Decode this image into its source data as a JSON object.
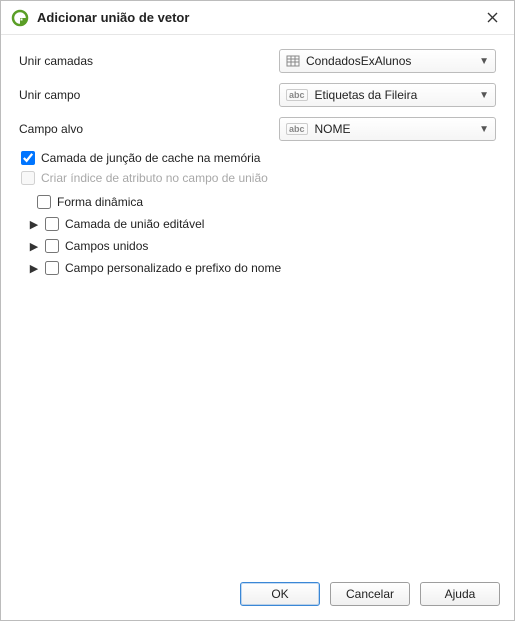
{
  "window": {
    "title": "Adicionar união de vetor"
  },
  "form": {
    "joinLayer": {
      "label": "Unir camadas",
      "value": "CondadosExAlunos"
    },
    "joinField": {
      "label": "Unir campo",
      "value": "Etiquetas da Fileira"
    },
    "targetField": {
      "label": "Campo alvo",
      "value": "NOME"
    }
  },
  "options": {
    "cacheJoin": {
      "label": "Camada de junção de cache na memória",
      "checked": true
    },
    "createIndex": {
      "label": "Criar índice de atributo no campo de união",
      "checked": false,
      "disabled": true
    },
    "dynamicForm": {
      "label": "Forma dinâmica",
      "checked": false
    },
    "editableJoin": {
      "label": "Camada de união editável",
      "checked": false
    },
    "joinedFields": {
      "label": "Campos unidos",
      "checked": false
    },
    "customPrefix": {
      "label": "Campo personalizado e prefixo do nome",
      "checked": false
    }
  },
  "buttons": {
    "ok": "OK",
    "cancel": "Cancelar",
    "help": "Ajuda"
  }
}
